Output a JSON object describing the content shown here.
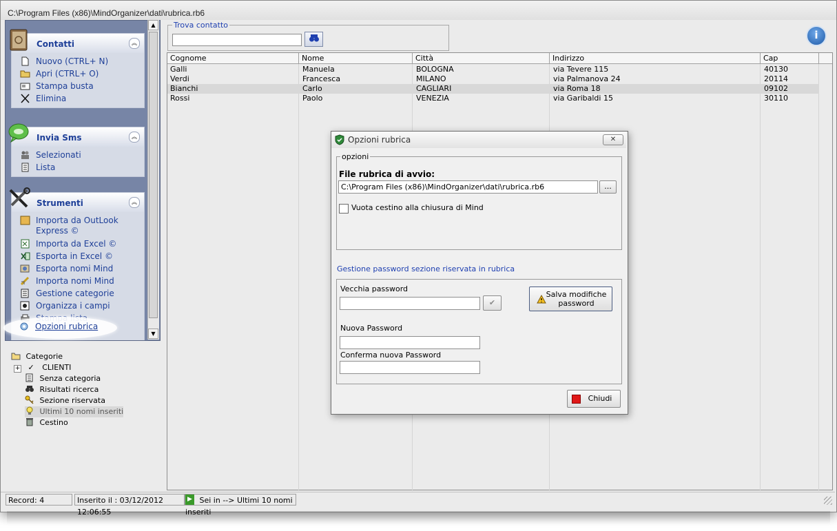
{
  "window": {
    "title": "C:\\Program Files (x86)\\MindOrganizer\\dati\\rubrica.rb6"
  },
  "sidebar": {
    "groups": [
      {
        "title": "Contatti",
        "icon": "address-book-icon",
        "items": [
          {
            "label": "Nuovo (CTRL+ N)",
            "icon": "new-document-icon"
          },
          {
            "label": "Apri (CTRL+ O)",
            "icon": "open-folder-icon"
          },
          {
            "label": "Stampa busta",
            "icon": "envelope-icon"
          },
          {
            "label": "Elimina",
            "icon": "delete-x-icon"
          }
        ]
      },
      {
        "title": "Invia Sms",
        "icon": "sms-bubble-icon",
        "items": [
          {
            "label": "Selezionati",
            "icon": "people-icon"
          },
          {
            "label": "Lista",
            "icon": "list-icon"
          }
        ]
      },
      {
        "title": "Strumenti",
        "icon": "tools-icon",
        "items": [
          {
            "label": "Importa da OutLook Express ©",
            "icon": "outlook-import-icon"
          },
          {
            "label": "Importa da Excel ©",
            "icon": "excel-import-icon"
          },
          {
            "label": "Esporta in Excel ©",
            "icon": "excel-export-icon"
          },
          {
            "label": "Esporta nomi Mind",
            "icon": "export-icon"
          },
          {
            "label": "Importa nomi Mind",
            "icon": "import-icon"
          },
          {
            "label": "Gestione categorie",
            "icon": "categories-icon"
          },
          {
            "label": "Organizza i campi",
            "icon": "fields-icon"
          },
          {
            "label": "Stampa lista",
            "icon": "printer-icon"
          },
          {
            "label": "Opzioni rubrica",
            "icon": "options-icon"
          }
        ]
      }
    ]
  },
  "tree": {
    "root": "Categorie",
    "items": [
      "CLIENTI",
      "Senza categoria",
      "Risultati ricerca",
      "Sezione riservata",
      "Ultimi 10 nomi inseriti",
      "Cestino"
    ]
  },
  "search": {
    "legend": "Trova contatto",
    "value": ""
  },
  "grid": {
    "columns": [
      "Cognome",
      "Nome",
      "Città",
      "Indirizzo",
      "Cap"
    ],
    "rows": [
      [
        "Galli",
        "Manuela",
        "BOLOGNA",
        "via Tevere 115",
        "40130"
      ],
      [
        "Verdi",
        "Francesca",
        "MILANO",
        "via Palmanova 24",
        "20114"
      ],
      [
        "Bianchi",
        "Carlo",
        "CAGLIARI",
        "via Roma 18",
        "09102"
      ],
      [
        "Rossi",
        "Paolo",
        "VENEZIA",
        "via Garibaldi 15",
        "30110"
      ]
    ],
    "selected_row": 2
  },
  "status": {
    "record": "Record: 4",
    "inserted": "Inserito il : 03/12/2012 12:06:55",
    "location": "Sei in --> Ultimi 10 nomi inseriti"
  },
  "dialog": {
    "title": "Opzioni rubrica",
    "close_glyph": "✕",
    "options_legend": "opzioni",
    "file_label": "File rubrica di avvio:",
    "file_value": "C:\\Program Files (x86)\\MindOrganizer\\dati\\rubrica.rb6",
    "browse_label": "...",
    "checkbox_label": "Vuota cestino alla chiusura di Mind",
    "checkbox_checked": false,
    "password_section": "Gestione password sezione riservata in rubrica",
    "old_password_label": "Vecchia password",
    "new_password_label": "Nuova Password",
    "confirm_password_label": "Conferma nuova Password",
    "save_button_line1": "Salva modifiche",
    "save_button_line2": "password",
    "close_button": "Chiudi"
  },
  "colors": {
    "accent": "#1e3f98",
    "sidebar_bg": "#7785a6",
    "link": "#1e3fb0"
  }
}
